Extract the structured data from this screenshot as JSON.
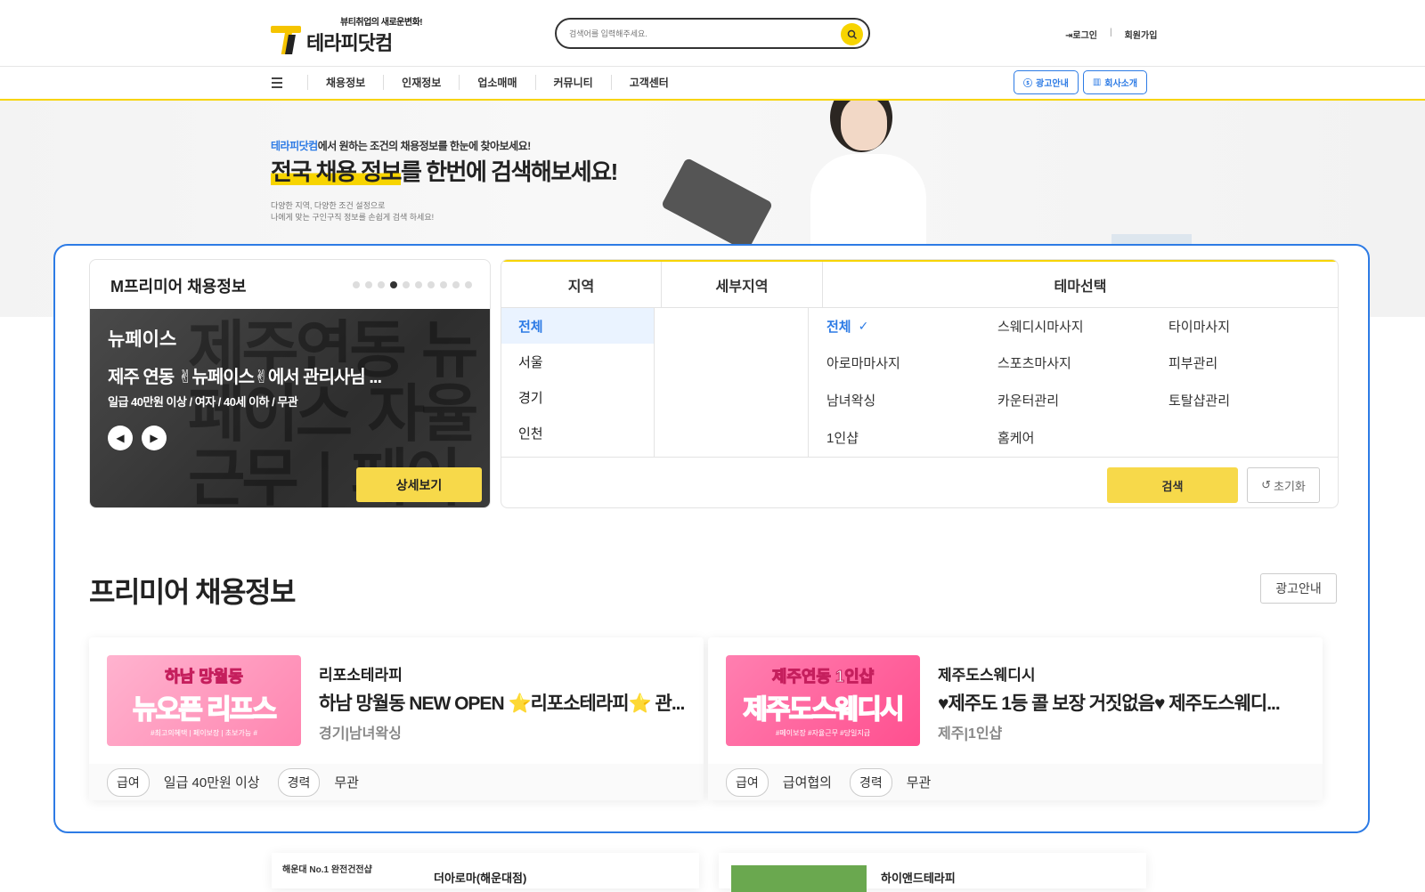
{
  "header": {
    "logo_sub": "뷰티취업의 새로운변화!",
    "logo_main": "테라피닷컴",
    "search_placeholder": "검색어를 입력해주세요.",
    "login": "로그인",
    "signup": "회원가입"
  },
  "nav": {
    "items": [
      "채용정보",
      "인재정보",
      "업소매매",
      "커뮤니티",
      "고객센터"
    ],
    "ad_info": "광고안내",
    "company_intro": "회사소개"
  },
  "hero": {
    "sub_brand": "테라피닷컴",
    "sub_rest": "에서 원하는 조건의 채용정보를 한눈에 찾아보세요!",
    "big_highlight": "전국 채용 정보",
    "big_rest": "를 한번에 검색해보세요!",
    "desc1": "다양한 지역, 다양한 조건 설정으로",
    "desc2": "나에게 맞는 구인구직 정보를 손쉽게 검색 하세요!"
  },
  "m_premium": {
    "title": "M프리미어 채용정보",
    "dots_total": 10,
    "dots_active_index": 3,
    "company": "뉴페이스",
    "headline": "제주 연동 ✌뉴페이스✌에서 관리사님 ...",
    "conditions": "일급 40만원 이상 / 여자 / 40세 이하 / 무관",
    "bg_text": "제주연동 뉴페이스 자율근무 | 페이보장",
    "detail_button": "상세보기"
  },
  "filter": {
    "headers": {
      "region": "지역",
      "subregion": "세부지역",
      "theme": "테마선택"
    },
    "regions": [
      "전체",
      "서울",
      "경기",
      "인천"
    ],
    "themes": [
      "전체",
      "스웨디시마사지",
      "타이마사지",
      "아로마마사지",
      "스포츠마사지",
      "피부관리",
      "남녀왁싱",
      "카운터관리",
      "토탈샵관리",
      "1인샵",
      "홈케어"
    ],
    "search_button": "검색",
    "reset_button": "초기화"
  },
  "premium": {
    "title": "프리미어 채용정보",
    "ad_button": "광고안내",
    "cards": [
      {
        "thumb_top": "하남 망월동",
        "thumb_main": "뉴오픈 리프스",
        "thumb_bottom": "#최고의혜택 | 페이보장 | 초보가능 #",
        "name": "리포소테라피",
        "headline": "하남 망월동 NEW OPEN ⭐리포소테라피⭐ 관...",
        "location": "경기|남녀왁싱",
        "pay_label": "급여",
        "pay_value": "일급 40만원 이상",
        "career_label": "경력",
        "career_value": "무관"
      },
      {
        "thumb_top": "제주연동 1인샵",
        "thumb_main": "제주도스웨디시",
        "thumb_bottom": "#페이보장 #자율근무 #당일지급",
        "name": "제주도스웨디시",
        "headline": "♥제주도 1등 콜 보장 거짓없음♥ 제주도스웨디...",
        "location": "제주|1인샵",
        "pay_label": "급여",
        "pay_value": "급여협의",
        "career_label": "경력",
        "career_value": "무관"
      }
    ]
  },
  "next_row": {
    "left_mini": "해운대 No.1 완전건전샵",
    "left_name": "더아로마(해운대점)",
    "right_name": "하이앤드테라피"
  }
}
